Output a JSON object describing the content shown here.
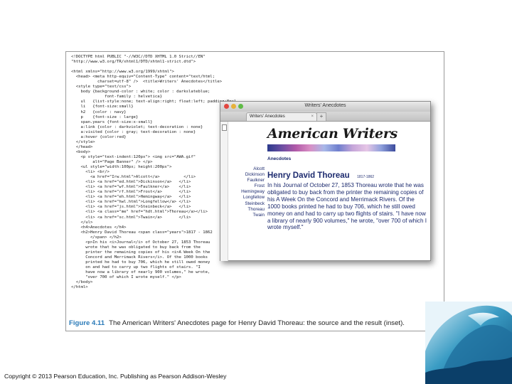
{
  "figure": {
    "code_lines": [
      "<!DOCTYPE html PUBLIC \"-//W3C//DTD XHTML 1.0 Strict//EN\"",
      "\"http://www.w3.org/TR/xhtml1/DTD/xhtml1-strict.dtd\">",
      "",
      "<html xmlns=\"http://www.w3.org/1999/xhtml\">",
      "  <head> <meta http-equiv=\"Content-Type\" content=\"text/html;",
      "           charset=utf-8\" />  <title>Writers' Anecdotes</title>",
      "  <style type=\"text/css\">",
      "    body {background-color : white; color : darkslateblue;",
      "              font-family : helvetica}",
      "    ul   {list-style:none; text-align:right; float:left; padding:8px}",
      "    li   {font-size:small}",
      "    h2   {color : navy}",
      "    p    {font-size : large}",
      "    span.years {font-size:x-small}",
      "    a:link {color : darkviolet; text-decoration : none}",
      "    a:visited {color : gray; text-decoration : none}",
      "    a:hover {color:red}",
      "  </style>",
      "  </head>",
      "  <body>",
      "    <p style=\"text-indent:120px\"> <img src=\"AWA.gif\"",
      "         alt=\"Page Banner\" /> </p>",
      "    <ul style=\"width:100px; height:200px\">",
      "      <li> <br/>",
      "        <a href=\"Irw.html\">Alcott</a>          </li>",
      "      <li> <a href=\"ed.html\">Dickinson</a>   </li>",
      "      <li> <a href=\"wf.html\">Faulkner</a>    </li>",
      "      <li> <a href=\"rf.html\">Frost</a>       </li>",
      "      <li> <a href=\"eh.html\">Hemingway</a>   </li>",
      "      <li> <a href=\"hwl.html\">Longfellow</a> </li>",
      "      <li> <a href=\"js.html\">Steinbeck</a>   </li>",
      "      <li> <a class=\"me\" href=\"hdt.html\">Thoreau</a></li>",
      "      <li> <a href=\"sc.html\">Twain</a>       </li>",
      "    </ul>",
      "    <h4>Anecdotes </h4>",
      "    <h2>Henry David Thoreau <span class=\"years\">1817 - 1862",
      "        </span> </h2>",
      "      <p>In his <i>Journal</i> of October 27, 1853 Thoreau",
      "      wrote that he was obligated to buy back from the",
      "      printer the remaining copies of his <i>A Week On the",
      "      Concord and Merrimack Rivers</i>. Of the 1000 books",
      "      printed he had to buy 706, which he still owed money",
      "      on and had to carry up two flights of stairs. \"I",
      "      have now a library of nearly 900 volumes,\" he wrote,",
      "      \"over 700 of which I wrote myself.\" </p>",
      "  </body>",
      "</html>"
    ],
    "caption_number": "Figure 4.11",
    "caption_text": "The American Writers' Anecdotes page for Henry David Thoreau: the source and the result (inset)."
  },
  "browser": {
    "window_title": "Writers' Anecdotes",
    "tab_label": "Writers' Anecdotes",
    "tab_close": "×",
    "new_tab": "+",
    "banner_text": "American Writers",
    "anecdotes_heading": "Anecdotes",
    "nav_items": [
      "Alcott",
      "Dickinson",
      "Faulkner",
      "Frost",
      "Hemingway",
      "Longfellow",
      "Steinbeck",
      "Thoreau",
      "Twain"
    ],
    "author_name": "Henry David Thoreau",
    "years": "1817-1862",
    "anecdote_text": "In his Journal of October 27, 1853 Thoreau wrote that he was obligated to buy back from the printer the remaining copies of his A Week On the Concord and Merrimack Rivers. Of the 1000 books printed he had to buy 706, which he still owed money on and had to carry up two flights of stairs. \"I have now a library of nearly 900 volumes,\" he wrote, \"over 700 of which I wrote myself.\""
  },
  "footer": {
    "copyright": "Copyright © 2013 Pearson Education, Inc. Publishing as Pearson Addison-Wesley"
  },
  "colors": {
    "caption_blue": "#2a7ab8",
    "page_text": "#1c2a6e"
  },
  "icons": {
    "wave": "ocean-wave-icon"
  }
}
